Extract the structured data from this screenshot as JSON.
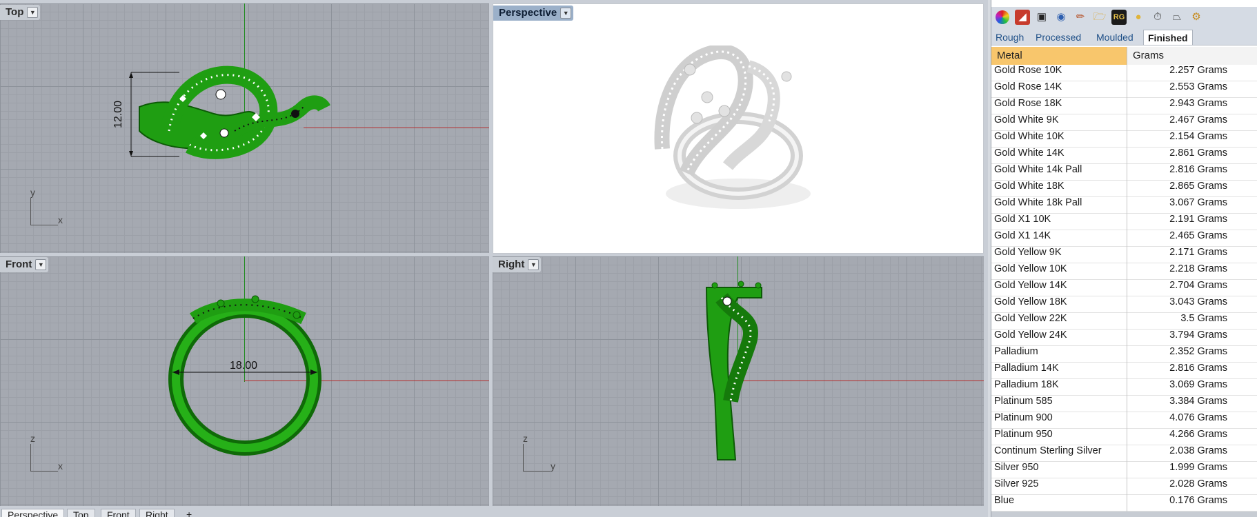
{
  "viewports": {
    "top": {
      "title": "Top",
      "cplane_v": "y",
      "cplane_h": "x",
      "dimension": "12.00"
    },
    "perspective": {
      "title": "Perspective"
    },
    "front": {
      "title": "Front",
      "cplane_v": "z",
      "cplane_h": "x",
      "dimension": "18.00"
    },
    "right": {
      "title": "Right",
      "cplane_v": "z",
      "cplane_h": "y"
    }
  },
  "viewport_tabs": [
    "Perspective",
    "Top",
    "Front",
    "Right",
    "+"
  ],
  "panel": {
    "subtabs": [
      "Rough",
      "Processed",
      "Moulded",
      "Finished"
    ],
    "active_subtab": "Finished",
    "columns": {
      "metal": "Metal",
      "grams": "Grams"
    },
    "rows": [
      {
        "metal": "Gold Rose 10K",
        "grams": "2.257 Grams"
      },
      {
        "metal": "Gold Rose 14K",
        "grams": "2.553 Grams"
      },
      {
        "metal": "Gold Rose 18K",
        "grams": "2.943 Grams"
      },
      {
        "metal": "Gold White 9K",
        "grams": "2.467 Grams"
      },
      {
        "metal": "Gold White 10K",
        "grams": "2.154 Grams"
      },
      {
        "metal": "Gold White 14K",
        "grams": "2.861 Grams"
      },
      {
        "metal": "Gold White 14k Pall",
        "grams": "2.816 Grams"
      },
      {
        "metal": "Gold White 18K",
        "grams": "2.865 Grams"
      },
      {
        "metal": "Gold White 18k Pall",
        "grams": "3.067 Grams"
      },
      {
        "metal": "Gold X1 10K",
        "grams": "2.191 Grams"
      },
      {
        "metal": "Gold X1 14K",
        "grams": "2.465 Grams"
      },
      {
        "metal": "Gold Yellow 9K",
        "grams": "2.171 Grams"
      },
      {
        "metal": "Gold Yellow 10K",
        "grams": "2.218 Grams"
      },
      {
        "metal": "Gold Yellow 14K",
        "grams": "2.704 Grams"
      },
      {
        "metal": "Gold Yellow 18K",
        "grams": "3.043 Grams"
      },
      {
        "metal": "Gold Yellow 22K",
        "grams": "3.5 Grams"
      },
      {
        "metal": "Gold Yellow 24K",
        "grams": "3.794 Grams"
      },
      {
        "metal": "Palladium",
        "grams": "2.352 Grams"
      },
      {
        "metal": "Palladium 14K",
        "grams": "2.816 Grams"
      },
      {
        "metal": "Palladium 18K",
        "grams": "3.069 Grams"
      },
      {
        "metal": "Platinum 585",
        "grams": "3.384 Grams"
      },
      {
        "metal": "Platinum 900",
        "grams": "4.076 Grams"
      },
      {
        "metal": "Platinum 950",
        "grams": "4.266 Grams"
      },
      {
        "metal": "Continum Sterling Silver",
        "grams": "2.038 Grams"
      },
      {
        "metal": "Silver 950",
        "grams": "1.999 Grams"
      },
      {
        "metal": "Silver 925",
        "grams": "2.028 Grams"
      },
      {
        "metal": "Blue",
        "grams": "0.176 Grams"
      }
    ],
    "toolbar_icons": [
      "color-wheel-icon",
      "material-icon",
      "display-icon",
      "render-icon",
      "brush-icon",
      "folder-icon",
      "rg-logo-icon",
      "gold-icon",
      "weight-icon",
      "trash-icon",
      "wrench-icon"
    ],
    "toolbar_rg_text": "RG"
  },
  "colors": {
    "ring_green": "#1f9e12",
    "metal_header": "#f8c66c",
    "active_viewport": "#9bb0c9"
  }
}
